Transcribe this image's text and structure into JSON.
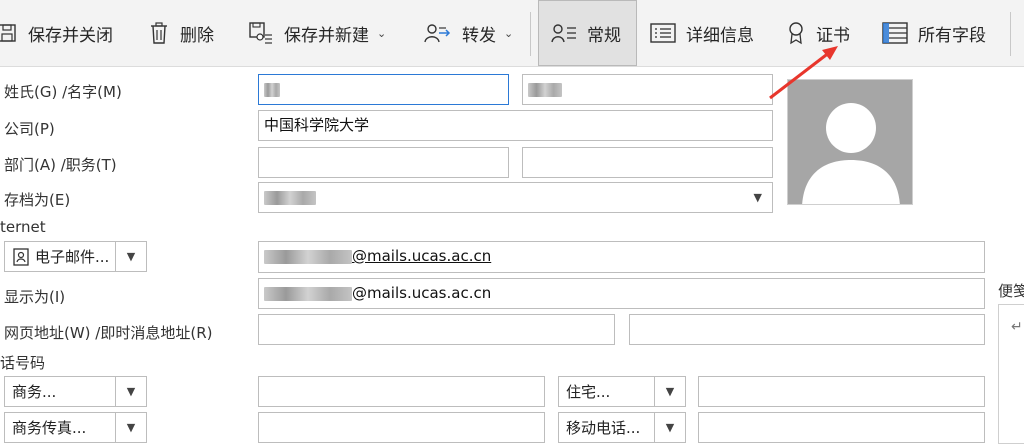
{
  "toolbar": {
    "save_close": "保存并关闭",
    "delete": "删除",
    "save_new": "保存并新建",
    "forward": "转发",
    "general": "常规",
    "details": "详细信息",
    "certificates": "证书",
    "all_fields": "所有字段"
  },
  "form": {
    "name_label": "姓氏(G)  /名字(M)",
    "company_label": "公司(P)",
    "company_value": "中国科学院大学",
    "dept_label": "部门(A)  /职务(T)",
    "file_as_label": "存档为(E)",
    "internet_section": "ternet",
    "email_type": "电子邮件...",
    "email_value": "@mails.ucas.ac.cn",
    "display_label": "显示为(I)",
    "display_value": "@mails.ucas.ac.cn",
    "web_label": "网页地址(W)  /即时消息地址(R)",
    "phone_section": "话号码",
    "phone_business": "商务...",
    "phone_home": "住宅...",
    "phone_business_fax": "商务传真...",
    "phone_mobile": "移动电话...",
    "notes_label": "便笺",
    "notes_mark": "↵"
  },
  "colors": {
    "ribbon_bg": "#f3f3f3",
    "active_tab": "#e1e1e1",
    "focus_border": "#2b79d6",
    "annotation_arrow": "#e8362c",
    "photo_bg": "#a6a6a6"
  }
}
